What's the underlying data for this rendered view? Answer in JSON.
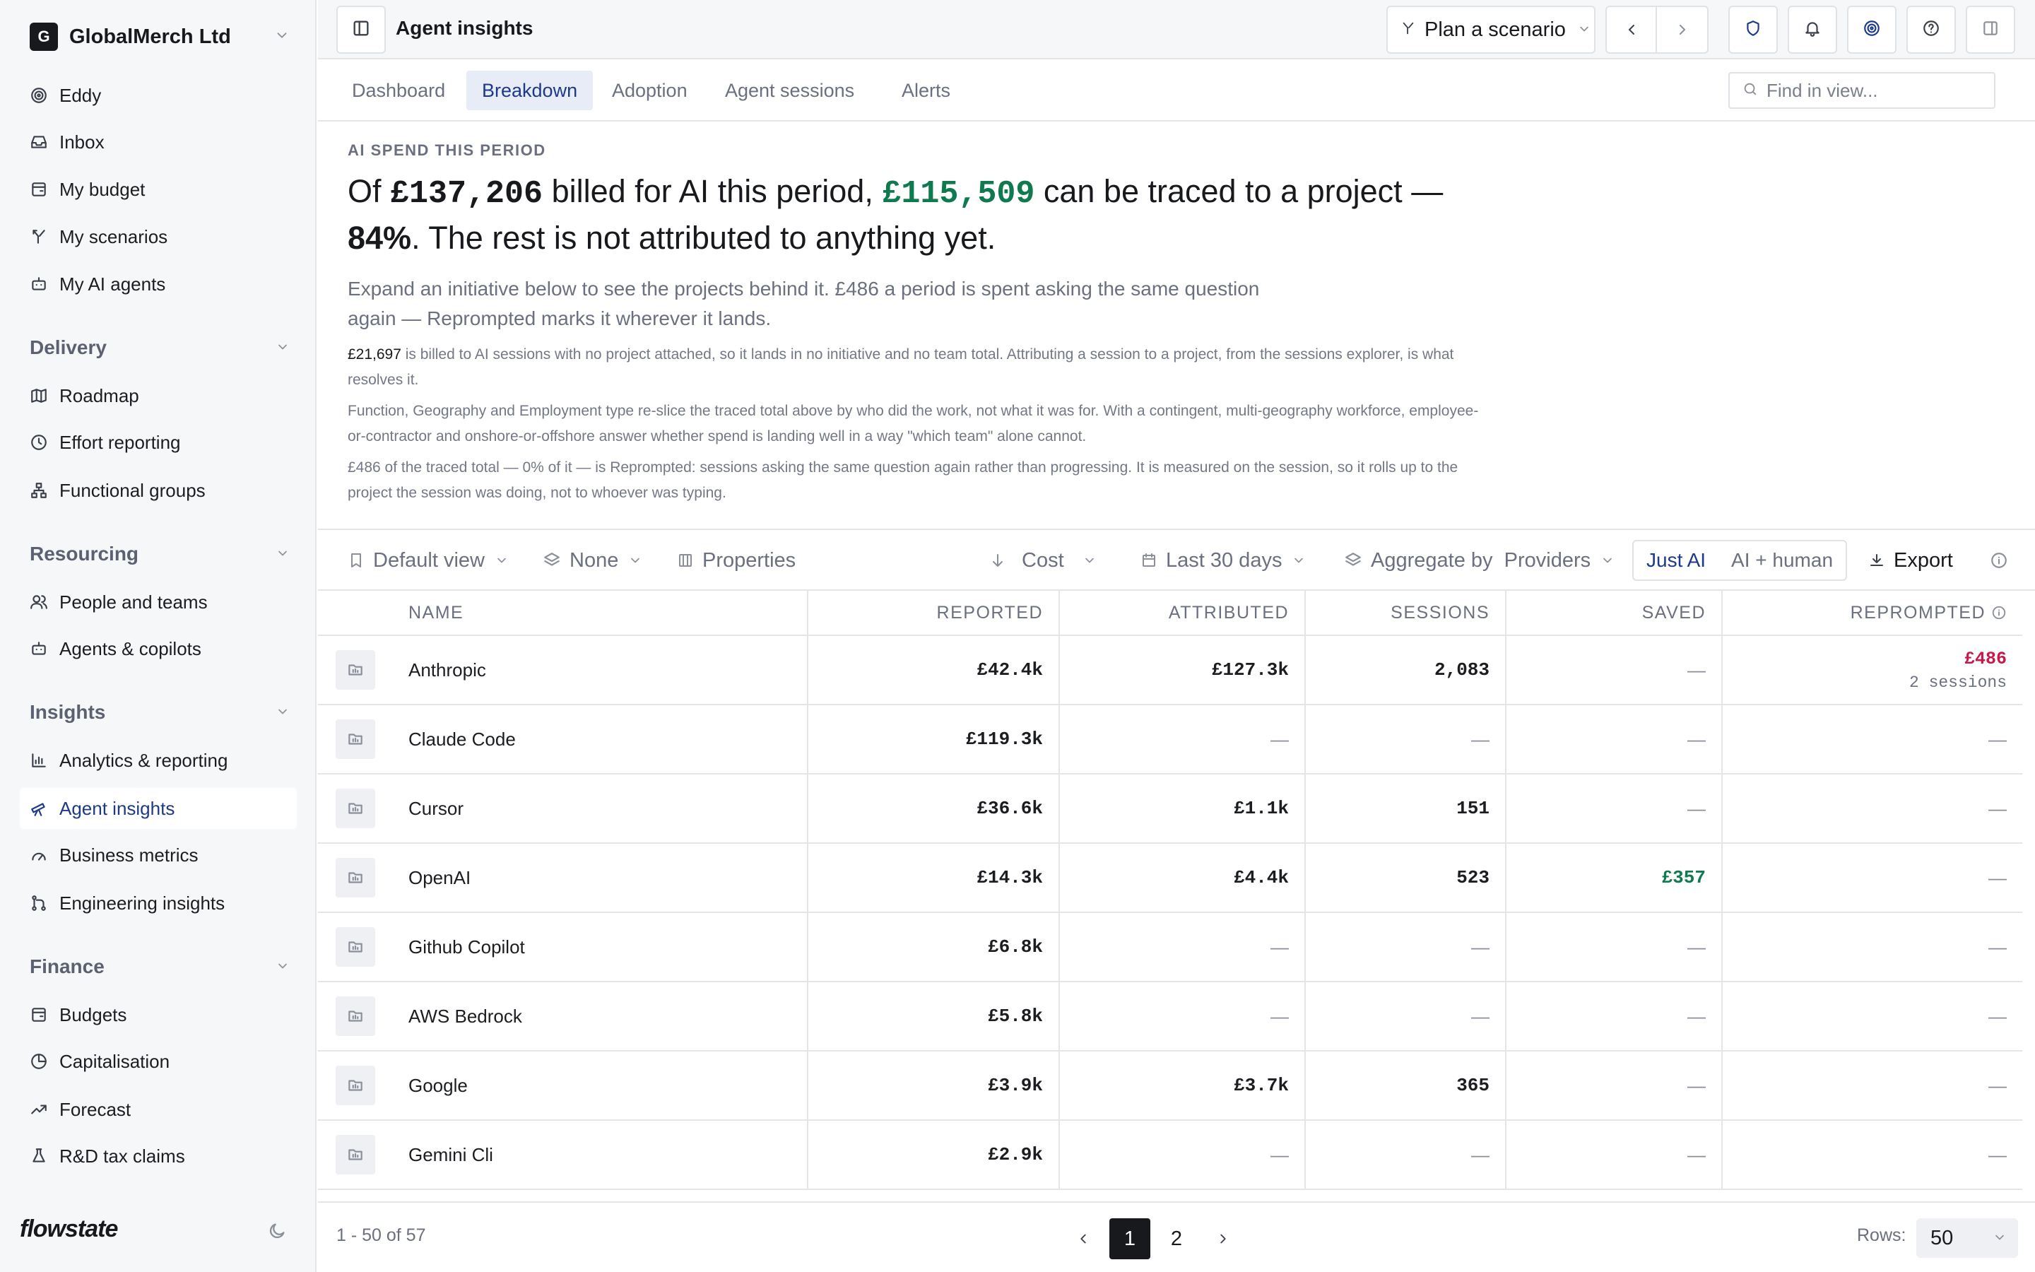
{
  "sidebar": {
    "org_initial": "G",
    "org_name": "GlobalMerch Ltd",
    "top_items": [
      {
        "label": "Eddy",
        "icon": "spiral-icon"
      },
      {
        "label": "Inbox",
        "icon": "inbox-icon"
      },
      {
        "label": "My budget",
        "icon": "wallet-icon"
      },
      {
        "label": "My scenarios",
        "icon": "branch-icon"
      },
      {
        "label": "My AI agents",
        "icon": "robot-icon"
      }
    ],
    "sections": [
      {
        "title": "Delivery",
        "items": [
          {
            "label": "Roadmap",
            "icon": "map-icon"
          },
          {
            "label": "Effort reporting",
            "icon": "clock-icon"
          },
          {
            "label": "Functional groups",
            "icon": "org-chart-icon"
          }
        ]
      },
      {
        "title": "Resourcing",
        "items": [
          {
            "label": "People and teams",
            "icon": "people-icon"
          },
          {
            "label": "Agents & copilots",
            "icon": "robot-icon"
          }
        ]
      },
      {
        "title": "Insights",
        "items": [
          {
            "label": "Analytics & reporting",
            "icon": "bar-chart-icon"
          },
          {
            "label": "Agent insights",
            "icon": "telescope-icon"
          },
          {
            "label": "Business metrics",
            "icon": "gauge-icon"
          },
          {
            "label": "Engineering insights",
            "icon": "git-icon"
          }
        ]
      },
      {
        "title": "Finance",
        "items": [
          {
            "label": "Budgets",
            "icon": "wallet-icon"
          },
          {
            "label": "Capitalisation",
            "icon": "pie-icon"
          },
          {
            "label": "Forecast",
            "icon": "trend-icon"
          },
          {
            "label": "R&D tax claims",
            "icon": "flask-icon"
          }
        ]
      }
    ],
    "active": "Agent insights",
    "brand": "flowstate"
  },
  "header": {
    "title": "Agent insights",
    "plan_label": "Plan a scenario"
  },
  "tabs": [
    "Dashboard",
    "Breakdown",
    "Adoption",
    "Agent sessions",
    "Alerts"
  ],
  "active_tab": "Breakdown",
  "search": {
    "placeholder": "Find in view..."
  },
  "summary": {
    "eyebrow": "AI SPEND THIS PERIOD",
    "h_pre": "Of ",
    "h_total": "£137,206",
    "h_mid": " billed for AI this period, ",
    "h_traced": "£115,509",
    "h_post": " can be traced to a project — ",
    "h_pct": "84%",
    "h_end": ". The rest is not attributed to anything yet.",
    "lede": "Expand an initiative below to see the projects behind it. £486 a period is spent asking the same question again — Reprompted marks it wherever it lands.",
    "note1_amount": "£21,697",
    "note1_text": " is billed to AI sessions with no project attached, so it lands in no initiative and no team total. Attributing a session to a project, from the sessions explorer, is what resolves it.",
    "note2": "Function, Geography and Employment type re-slice the traced total above by who did the work, not what it was for. With a contingent, multi-geography workforce, employee-or-contractor and onshore-or-offshore answer whether spend is landing well in a way \"which team\" alone cannot.",
    "note3": "£486 of the traced total — 0% of it — is Reprompted: sessions asking the same question again rather than progressing. It is measured on the session, so it rolls up to the project the session was doing, not to whoever was typing."
  },
  "toolbar": {
    "view": "Default view",
    "group": "None",
    "properties": "Properties",
    "sort": "Cost",
    "period": "Last 30 days",
    "aggregate_prefix": "Aggregate by",
    "aggregate_value": "Providers",
    "toggle_on": "Just AI",
    "toggle_off": "AI + human",
    "export": "Export"
  },
  "table": {
    "columns": [
      "NAME",
      "REPORTED",
      "ATTRIBUTED",
      "SESSIONS",
      "SAVED",
      "REPROMPTED"
    ],
    "rows": [
      {
        "name": "Anthropic",
        "reported": "£42.4k",
        "attributed": "£127.3k",
        "sessions": "2,083",
        "saved": "—",
        "reprompted": "£486",
        "reprompted_sessions": "2 sessions"
      },
      {
        "name": "Claude Code",
        "reported": "£119.3k",
        "attributed": "—",
        "sessions": "—",
        "saved": "—",
        "reprompted": "—",
        "reprompted_sessions": ""
      },
      {
        "name": "Cursor",
        "reported": "£36.6k",
        "attributed": "£1.1k",
        "sessions": "151",
        "saved": "—",
        "reprompted": "—",
        "reprompted_sessions": ""
      },
      {
        "name": "OpenAI",
        "reported": "£14.3k",
        "attributed": "£4.4k",
        "sessions": "523",
        "saved": "£357",
        "reprompted": "—",
        "reprompted_sessions": ""
      },
      {
        "name": "Github Copilot",
        "reported": "£6.8k",
        "attributed": "—",
        "sessions": "—",
        "saved": "—",
        "reprompted": "—",
        "reprompted_sessions": ""
      },
      {
        "name": "AWS Bedrock",
        "reported": "£5.8k",
        "attributed": "—",
        "sessions": "—",
        "saved": "—",
        "reprompted": "—",
        "reprompted_sessions": ""
      },
      {
        "name": "Google",
        "reported": "£3.9k",
        "attributed": "£3.7k",
        "sessions": "365",
        "saved": "—",
        "reprompted": "—",
        "reprompted_sessions": ""
      },
      {
        "name": "Gemini Cli",
        "reported": "£2.9k",
        "attributed": "—",
        "sessions": "—",
        "saved": "—",
        "reprompted": "—",
        "reprompted_sessions": ""
      }
    ]
  },
  "footer": {
    "range": "1 - 50 of 57",
    "pages": [
      "1",
      "2"
    ],
    "current_page": "1",
    "rows_label": "Rows:",
    "rows_value": "50"
  },
  "colors": {
    "accent": "#1d3a8a",
    "positive": "#0f7a50",
    "negative": "#c8184a"
  }
}
